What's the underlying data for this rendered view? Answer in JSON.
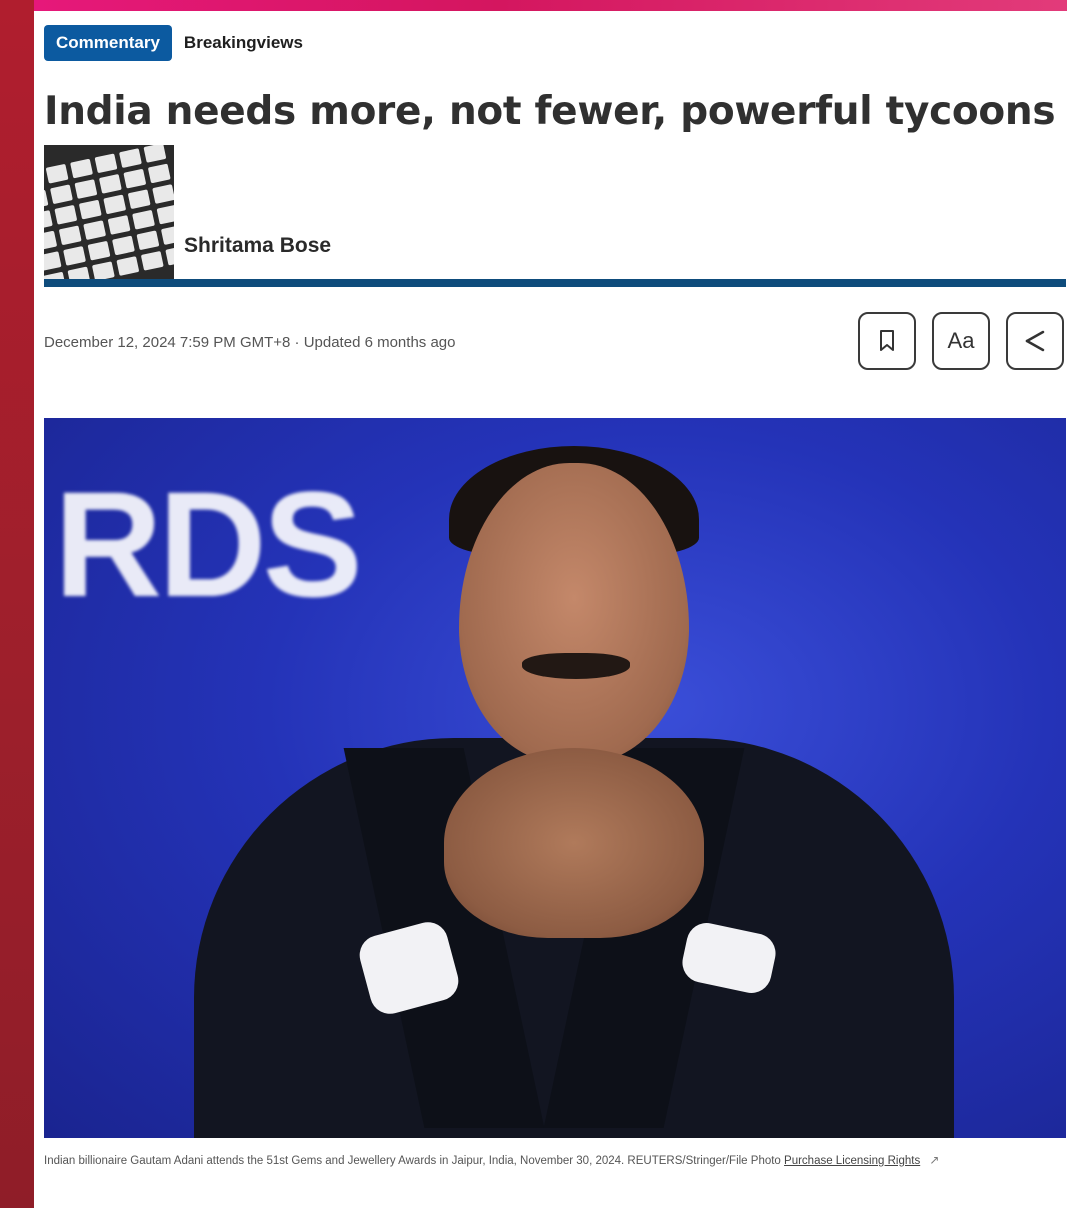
{
  "tags": {
    "primary": "Commentary",
    "secondary": "Breakingviews"
  },
  "article": {
    "headline": "India needs more, not fewer, powerful tycoons",
    "author": "Shritama Bose",
    "dateline": "December 12, 2024 7:59 PM GMT+8 · Updated 6 months ago"
  },
  "toolbar": {
    "bookmark_icon": "bookmark-icon",
    "text_size_label": "Aa",
    "share_icon": "share-icon"
  },
  "hero": {
    "backdrop_text": "RDS"
  },
  "caption": {
    "text": "Indian billionaire Gautam Adani attends the 51st Gems and Jewellery Awards in Jaipur, India, November 30, 2024. REUTERS/Stringer/File Photo",
    "link": "Purchase Licensing Rights",
    "link_icon": "external-link-icon"
  },
  "colors": {
    "accent": "#0c5aa0",
    "rule": "#0e4c7c",
    "rail": "#9c1f2b",
    "top_strip": "#e6187a"
  }
}
